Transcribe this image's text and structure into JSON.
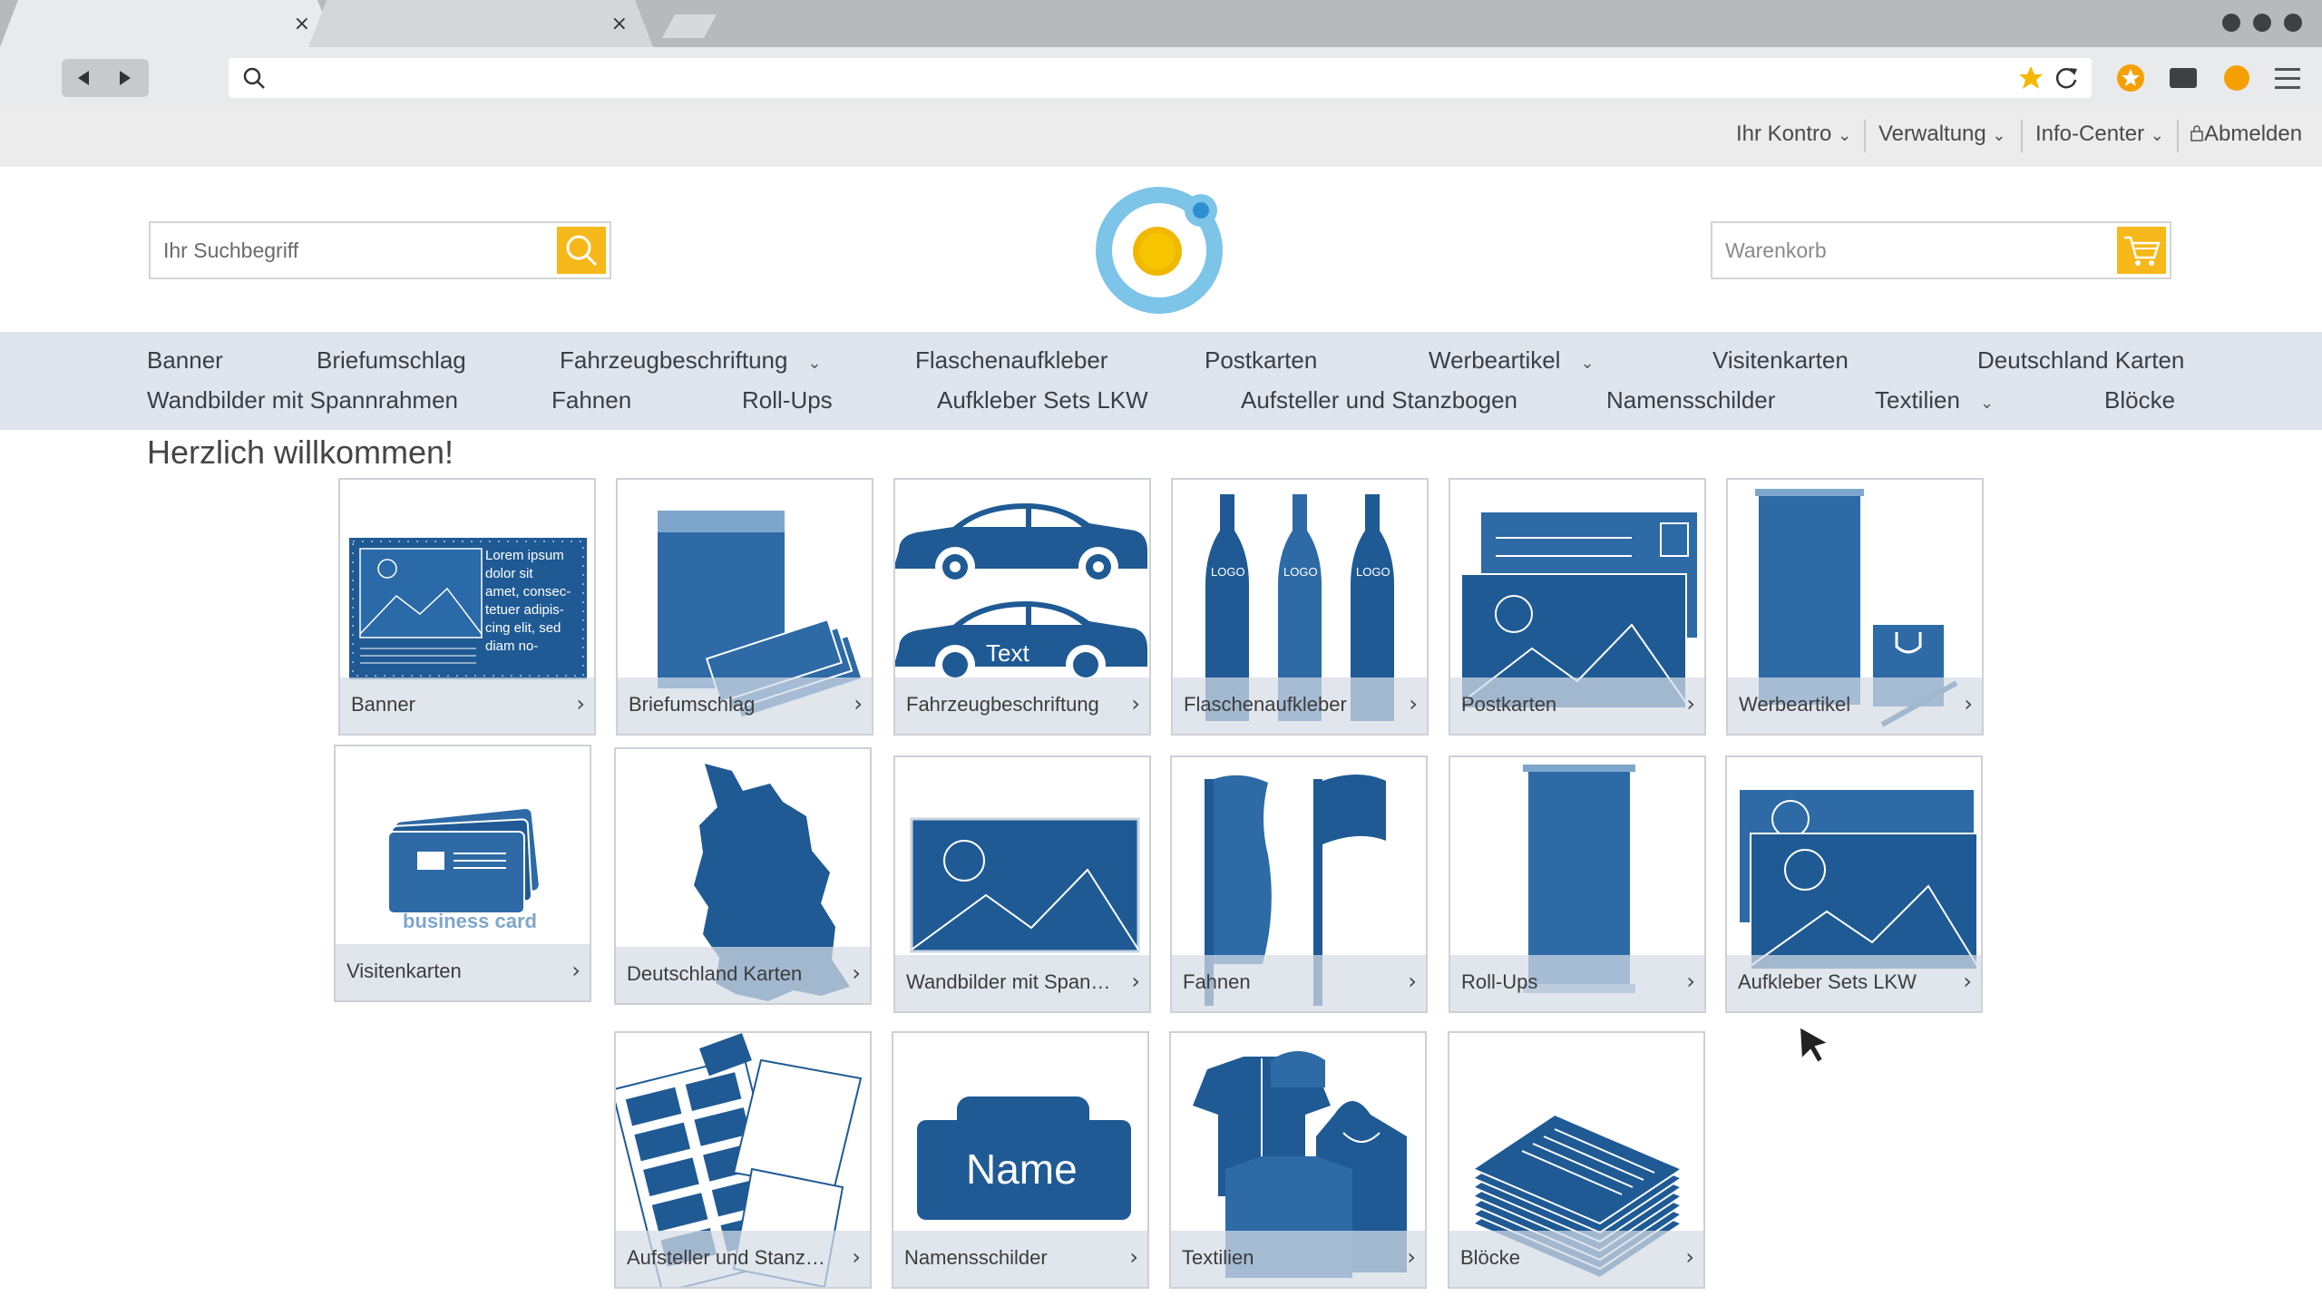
{
  "browser": {
    "tabs": [
      {
        "close": "×"
      },
      {
        "close": "×"
      }
    ],
    "colors": {
      "accent_star": "#f5b800",
      "ext_orange": "#f5a000"
    }
  },
  "topmenu": [
    {
      "label": "Ihr Kontro"
    },
    {
      "label": "Verwaltung"
    },
    {
      "label": "Info-Center"
    },
    {
      "label": "Abmelden"
    }
  ],
  "search": {
    "placeholder": "Ihr Suchbegriff"
  },
  "cart": {
    "placeholder": "Warenkorb"
  },
  "categories": [
    {
      "label": "Banner"
    },
    {
      "label": "Briefumschlag"
    },
    {
      "label": "Fahrzeugbeschriftung",
      "dropdown": true
    },
    {
      "label": "Flaschenaufkleber"
    },
    {
      "label": "Postkarten"
    },
    {
      "label": "Werbeartikel",
      "dropdown": true
    },
    {
      "label": "Visitenkarten"
    },
    {
      "label": "Deutschland Karten"
    },
    {
      "label": "Wandbilder mit Spannrahmen"
    },
    {
      "label": "Fahnen"
    },
    {
      "label": "Roll-Ups"
    },
    {
      "label": "Aufkleber Sets LKW"
    },
    {
      "label": "Aufsteller und Stanzbogen"
    },
    {
      "label": "Namensschilder"
    },
    {
      "label": "Textilien",
      "dropdown": true
    },
    {
      "label": "Blöcke"
    }
  ],
  "welcome": "Herzlich willkommen!",
  "tiles": [
    {
      "label": "Banner",
      "icon": "banner-icon",
      "banner_text": "Lorem ipsum dolor sit amet, consec-tetuer adipis-cing elit, sed diam no-"
    },
    {
      "label": "Briefumschlag",
      "icon": "envelope-icon"
    },
    {
      "label": "Fahrzeugbeschriftung",
      "icon": "car-icon",
      "car_text": "Text"
    },
    {
      "label": "Flaschenaufkleber",
      "icon": "bottles-icon",
      "bottle_text": "LOGO"
    },
    {
      "label": "Postkarten",
      "icon": "postcard-icon"
    },
    {
      "label": "Werbeartikel",
      "icon": "promo-items-icon"
    },
    {
      "label": "Visitenkarten",
      "icon": "business-cards-icon",
      "card_text": "business card"
    },
    {
      "label": "Deutschland Karten",
      "icon": "germany-map-icon"
    },
    {
      "label": "Wandbilder mit Spannrahmen",
      "icon": "wall-picture-icon"
    },
    {
      "label": "Fahnen",
      "icon": "flags-icon"
    },
    {
      "label": "Roll-Ups",
      "icon": "rollup-icon"
    },
    {
      "label": "Aufkleber Sets LKW",
      "icon": "sticker-set-icon"
    },
    {
      "label": "Aufsteller und Stanzbogen",
      "icon": "die-cut-sheet-icon"
    },
    {
      "label": "Namensschilder",
      "icon": "name-badge-icon",
      "badge_text": "Name"
    },
    {
      "label": "Textilien",
      "icon": "textiles-icon"
    },
    {
      "label": "Blöcke",
      "icon": "notepads-icon"
    }
  ],
  "colors": {
    "brand_blue": "#1f5a94",
    "nav_bg": "#dfe5ed",
    "button_yellow": "#f6b81a",
    "logo_ring": "#7cc4e8",
    "logo_core": "#f7b500"
  }
}
